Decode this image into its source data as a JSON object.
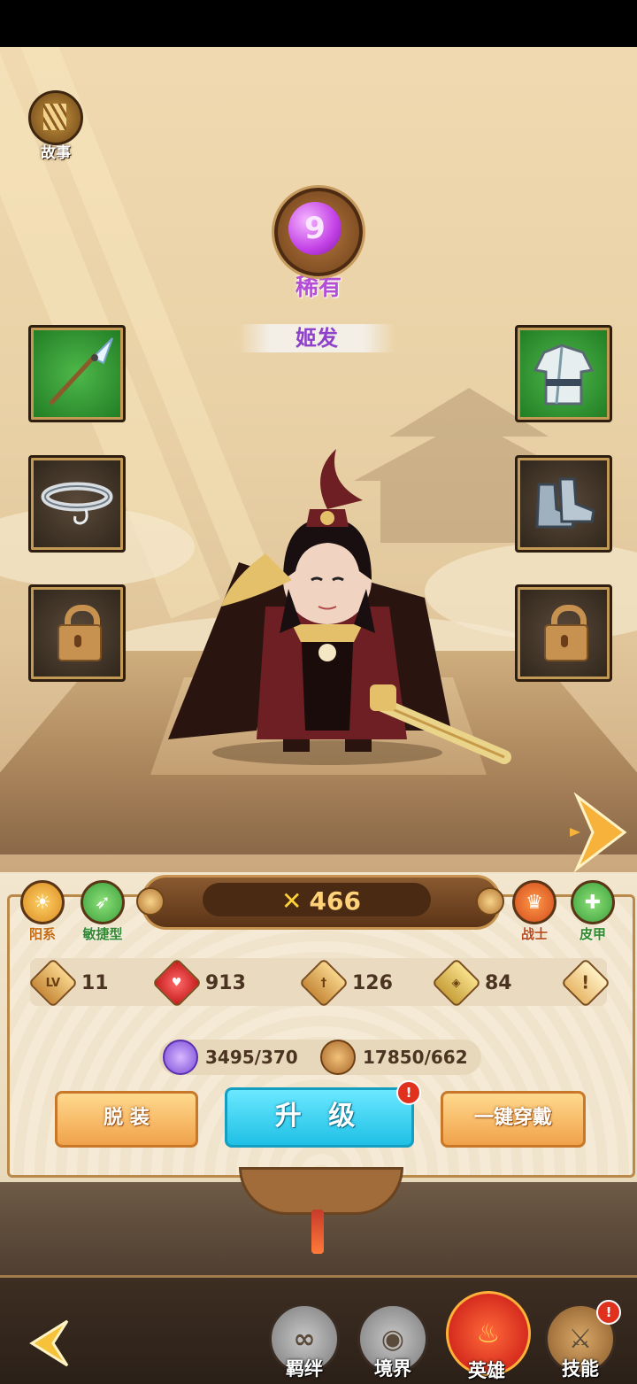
{
  "story": {
    "label": "故事",
    "icon": "book-icon"
  },
  "rarity": {
    "label": "稀有",
    "glyph": "9",
    "icon": "rare-gem-icon"
  },
  "hero": {
    "name": "姬发"
  },
  "equipment_slots": [
    {
      "slot": "weapon",
      "icon": "spear-icon",
      "state": "equipped"
    },
    {
      "slot": "armor",
      "icon": "armor-icon",
      "state": "equipped"
    },
    {
      "slot": "belt",
      "icon": "belt-icon",
      "state": "equipped"
    },
    {
      "slot": "boots",
      "icon": "boots-icon",
      "state": "equipped"
    },
    {
      "slot": "locked-left",
      "icon": "lock-icon",
      "state": "locked"
    },
    {
      "slot": "locked-right",
      "icon": "lock-icon",
      "state": "locked"
    }
  ],
  "power": {
    "value": "466",
    "icon": "crossed-swords-icon"
  },
  "traits_left": [
    {
      "label": "阳系",
      "icon": "sun-icon",
      "color": "#d98a1e"
    },
    {
      "label": "敏捷型",
      "icon": "agility-icon",
      "color": "#3aa03a"
    }
  ],
  "traits_right": [
    {
      "label": "战士",
      "icon": "warrior-icon",
      "color": "#d24a1a"
    },
    {
      "label": "皮甲",
      "icon": "leather-armor-icon",
      "color": "#3aa03a"
    }
  ],
  "stats": [
    {
      "icon": "level-icon",
      "badge": "LV",
      "value": "11"
    },
    {
      "icon": "health-icon",
      "badge": "",
      "value": "913"
    },
    {
      "icon": "attack-icon",
      "badge": "",
      "value": "126"
    },
    {
      "icon": "defense-icon",
      "badge": "",
      "value": "84"
    }
  ],
  "stats_info": {
    "badge": "!",
    "icon": "info-icon"
  },
  "resources": [
    {
      "icon": "spirit-orb-icon",
      "value": "3495/370"
    },
    {
      "icon": "copper-coin-icon",
      "value": "17850/662"
    }
  ],
  "buttons": {
    "unequip": "脱 装",
    "upgrade": "升 级",
    "upgrade_badge": "!",
    "equip_all": "一键穿戴"
  },
  "nav": [
    {
      "label": "羁绊",
      "icon": "bond-icon",
      "glyph": "∞",
      "active": false
    },
    {
      "label": "境界",
      "icon": "realm-icon",
      "glyph": "◉",
      "active": false
    },
    {
      "label": "英雄",
      "icon": "hero-flame-icon",
      "glyph": "♨",
      "active": true
    },
    {
      "label": "技能",
      "icon": "skill-sword-icon",
      "glyph": "⚔",
      "active": false
    }
  ],
  "nav_skill_badge": "!",
  "colors": {
    "rarity": "#b34fd6",
    "upgrade": "#1fc0e6",
    "action": "#f0a24a",
    "active_nav": "#c41212"
  }
}
